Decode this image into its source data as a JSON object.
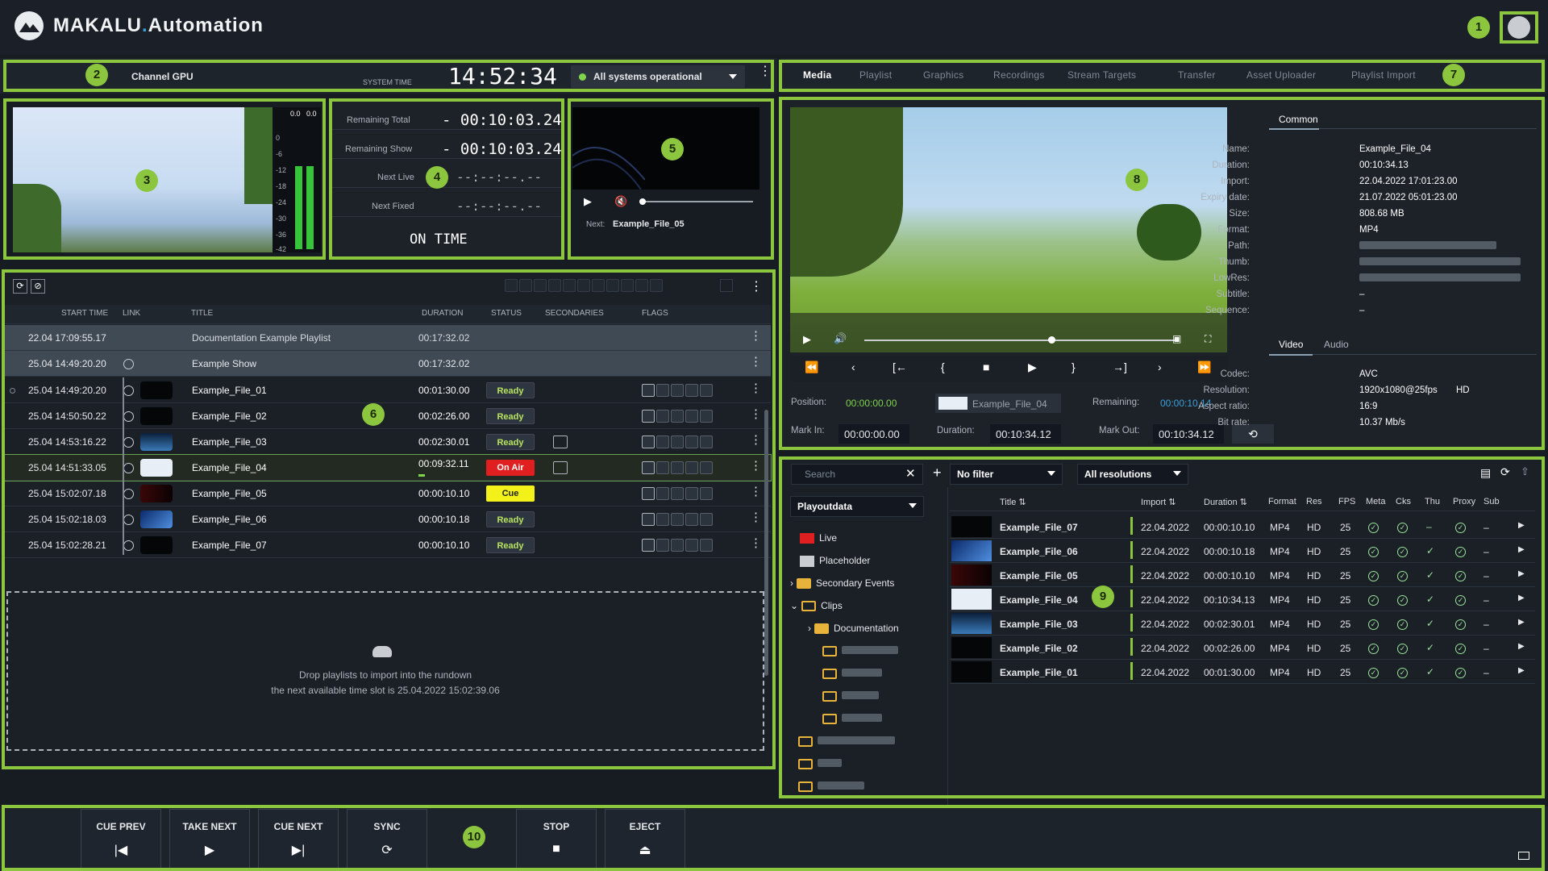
{
  "app": {
    "brand_main": "MAKALU",
    "brand_sep": ".",
    "brand_sub": "Automation"
  },
  "badges": [
    "1",
    "2",
    "3",
    "4",
    "5",
    "6",
    "7",
    "8",
    "9",
    "10"
  ],
  "channel": {
    "name": "Channel GPU",
    "system_time_label": "SYSTEM TIME",
    "time": "14:52:34",
    "status": "All systems operational"
  },
  "audio_meter": {
    "labels": [
      "0.0",
      "0.0"
    ],
    "scale": [
      "0",
      "-6",
      "-12",
      "-18",
      "-24",
      "-30",
      "-36",
      "-42"
    ],
    "level_left": 0.6,
    "level_right": 0.6
  },
  "timers": {
    "remaining_total_label": "Remaining Total",
    "remaining_total": "- 00:10:03.24",
    "remaining_show_label": "Remaining Show",
    "remaining_show": "- 00:10:03.24",
    "next_live_label": "Next Live",
    "next_live": "--:--:--.--",
    "next_fixed_label": "Next Fixed",
    "next_fixed": "--:--:--.--",
    "on_time": "ON TIME"
  },
  "preview": {
    "next_label": "Next:",
    "next_value": "Example_File_05"
  },
  "rundown": {
    "columns": {
      "start": "START TIME",
      "link": "LINK",
      "title": "TITLE",
      "duration": "DURATION",
      "status": "STATUS",
      "secondaries": "SECONDARIES",
      "flags": "FLAGS"
    },
    "playlist_row": {
      "start": "22.04  17:09:55.17",
      "title": "Documentation Example Playlist",
      "duration": "00:17:32.02"
    },
    "show_row": {
      "start": "25.04  14:49:20.20",
      "title": "Example Show",
      "duration": "00:17:32.02"
    },
    "items": [
      {
        "start": "25.04  14:49:20.20",
        "title": "Example_File_01",
        "duration": "00:01:30.00",
        "status": "Ready"
      },
      {
        "start": "25.04  14:50:50.22",
        "title": "Example_File_02",
        "duration": "00:02:26.00",
        "status": "Ready"
      },
      {
        "start": "25.04  14:53:16.22",
        "title": "Example_File_03",
        "duration": "00:02:30.01",
        "status": "Ready"
      },
      {
        "start": "25.04  14:51:33.05",
        "title": "Example_File_04",
        "duration": "00:09:32.11",
        "status": "On Air"
      },
      {
        "start": "25.04  15:02:07.18",
        "title": "Example_File_05",
        "duration": "00:00:10.10",
        "status": "Cue"
      },
      {
        "start": "25.04  15:02:18.03",
        "title": "Example_File_06",
        "duration": "00:00:10.18",
        "status": "Ready"
      },
      {
        "start": "25.04  15:02:28.21",
        "title": "Example_File_07",
        "duration": "00:00:10.10",
        "status": "Ready"
      }
    ],
    "drop_line1": "Drop playlists to import into the rundown",
    "drop_line2": "the next available time slot is 25.04.2022 15:02:39.06"
  },
  "tabs": [
    "Media",
    "Playlist",
    "Graphics",
    "Recordings",
    "Stream Targets",
    "Transfer",
    "Asset Uploader",
    "Playlist Import"
  ],
  "media": {
    "common_tab": "Common",
    "meta": {
      "name_label": "Name:",
      "name": "Example_File_04",
      "duration_label": "Duration:",
      "duration": "00:10:34.13",
      "import_label": "Import:",
      "import": "22.04.2022 17:01:23.00",
      "expiry_label": "Expiry date:",
      "expiry": "21.07.2022 05:01:23.00",
      "size_label": "Size:",
      "size": "808.68 MB",
      "format_label": "Format:",
      "format": "MP4",
      "path_label": "Path:",
      "thumb_label": "Thumb:",
      "lowres_label": "LowRes:",
      "subtitle_label": "Subtitle:",
      "subtitle": "–",
      "sequence_label": "Sequence:",
      "sequence": "–"
    },
    "av_tabs": [
      "Video",
      "Audio"
    ],
    "video": {
      "codec_label": "Codec:",
      "codec": "AVC",
      "resolution_label": "Resolution:",
      "resolution": "1920x1080@25fps",
      "hd": "HD",
      "aspect_label": "Aspect ratio:",
      "aspect": "16:9",
      "bitrate_label": "Bit rate:",
      "bitrate": "10.37 Mb/s"
    },
    "player": {
      "position_label": "Position:",
      "position": "00:00:00.00",
      "file": "Example_File_04",
      "remaining_label": "Remaining:",
      "remaining": "00:00:10.14",
      "markin_label": "Mark In:",
      "markin": "00:00:00.00",
      "duration_label": "Duration:",
      "duration": "00:10:34.12",
      "markout_label": "Mark Out:",
      "markout": "00:10:34.12",
      "progress": 0.6
    }
  },
  "library": {
    "search_placeholder": "Search",
    "filter": "No filter",
    "resolution": "All resolutions",
    "source": "Playoutdata",
    "tree": [
      "Live",
      "Placeholder",
      "Secondary Events",
      "Clips",
      "Documentation"
    ],
    "columns": {
      "title": "Title",
      "import": "Import",
      "duration": "Duration",
      "format": "Format",
      "res": "Res",
      "fps": "FPS",
      "meta": "Meta",
      "cks": "Cks",
      "thu": "Thu",
      "proxy": "Proxy",
      "sub": "Sub"
    },
    "rows": [
      {
        "title": "Example_File_07",
        "import": "22.04.2022",
        "duration": "00:00:10.10",
        "format": "MP4",
        "res": "HD",
        "fps": "25",
        "thu": "–",
        "sub": "–"
      },
      {
        "title": "Example_File_06",
        "import": "22.04.2022",
        "duration": "00:00:10.18",
        "format": "MP4",
        "res": "HD",
        "fps": "25",
        "thu": "✓",
        "sub": "–"
      },
      {
        "title": "Example_File_05",
        "import": "22.04.2022",
        "duration": "00:00:10.10",
        "format": "MP4",
        "res": "HD",
        "fps": "25",
        "thu": "✓",
        "sub": "–"
      },
      {
        "title": "Example_File_04",
        "import": "22.04.2022",
        "duration": "00:10:34.13",
        "format": "MP4",
        "res": "HD",
        "fps": "25",
        "thu": "✓",
        "sub": "–"
      },
      {
        "title": "Example_File_03",
        "import": "22.04.2022",
        "duration": "00:02:30.01",
        "format": "MP4",
        "res": "HD",
        "fps": "25",
        "thu": "✓",
        "sub": "–"
      },
      {
        "title": "Example_File_02",
        "import": "22.04.2022",
        "duration": "00:02:26.00",
        "format": "MP4",
        "res": "HD",
        "fps": "25",
        "thu": "✓",
        "sub": "–"
      },
      {
        "title": "Example_File_01",
        "import": "22.04.2022",
        "duration": "00:01:30.00",
        "format": "MP4",
        "res": "HD",
        "fps": "25",
        "thu": "✓",
        "sub": "–"
      }
    ]
  },
  "controls": {
    "cue_prev": "CUE PREV",
    "take_next": "TAKE NEXT",
    "cue_next": "CUE NEXT",
    "sync": "SYNC",
    "stop": "STOP",
    "eject": "EJECT"
  }
}
